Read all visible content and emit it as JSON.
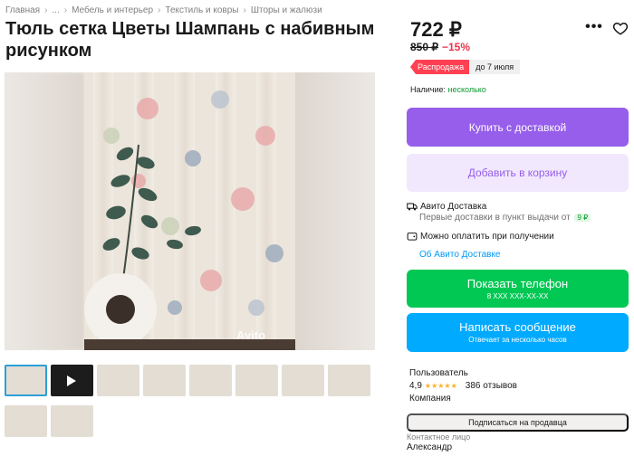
{
  "breadcrumbs": [
    "Главная",
    "...",
    "Мебель и интерьер",
    "Текстиль и ковры",
    "Шторы и жалюзи"
  ],
  "title": "Тюль сетка Цветы Шампань с набивным рисунком",
  "photo": {
    "watermark": "Avito"
  },
  "thumbnails": [
    {
      "kind": "photo",
      "active": true
    },
    {
      "kind": "video",
      "active": false
    },
    {
      "kind": "photo",
      "active": false
    },
    {
      "kind": "photo",
      "active": false
    },
    {
      "kind": "photo",
      "active": false
    },
    {
      "kind": "photo",
      "active": false
    },
    {
      "kind": "photo",
      "active": false
    },
    {
      "kind": "photo",
      "active": false
    },
    {
      "kind": "photo",
      "active": false
    },
    {
      "kind": "photo",
      "active": false
    }
  ],
  "price": {
    "current": "722 ₽",
    "old": "850 ₽",
    "discount": "−15%"
  },
  "sale_badge": {
    "label": "Распродажа",
    "until": "до 7 июля"
  },
  "stock": {
    "label": "Наличие:",
    "value": "несколько"
  },
  "buttons": {
    "buy": "Купить с доставкой",
    "cart": "Добавить в корзину",
    "phone": "Показать телефон",
    "phone_sub": "8 XXX XXX-XX-XX",
    "message": "Написать сообщение",
    "message_sub": "Отвечает за несколько часов",
    "subscribe": "Подписаться на продавца"
  },
  "delivery": {
    "title": "Авито Доставка",
    "note": "Первые доставки в пункт выдачи от",
    "note_tag": "9 ₽",
    "pay": "Можно оплатить при получении",
    "link": "Об Авито Доставке"
  },
  "seller": {
    "role": "Пользователь",
    "rating": "4,9",
    "stars": "★★★★★",
    "reviews": "386 отзывов",
    "type": "Компания"
  },
  "contact": {
    "label": "Контактное лицо",
    "name": "Александр"
  },
  "colors": {
    "buy": "#965eeb",
    "cart_bg": "#f1e8fd",
    "phone": "#00c853",
    "message": "#00aaff",
    "discount": "#e8344b",
    "sale": "#ff4053",
    "link": "#0099f7",
    "stock": "#0a9a2f"
  },
  "icons": {
    "more": "more-dots-icon",
    "favorite": "heart-icon",
    "truck": "truck-icon",
    "wallet": "wallet-icon",
    "play": "play-icon"
  }
}
